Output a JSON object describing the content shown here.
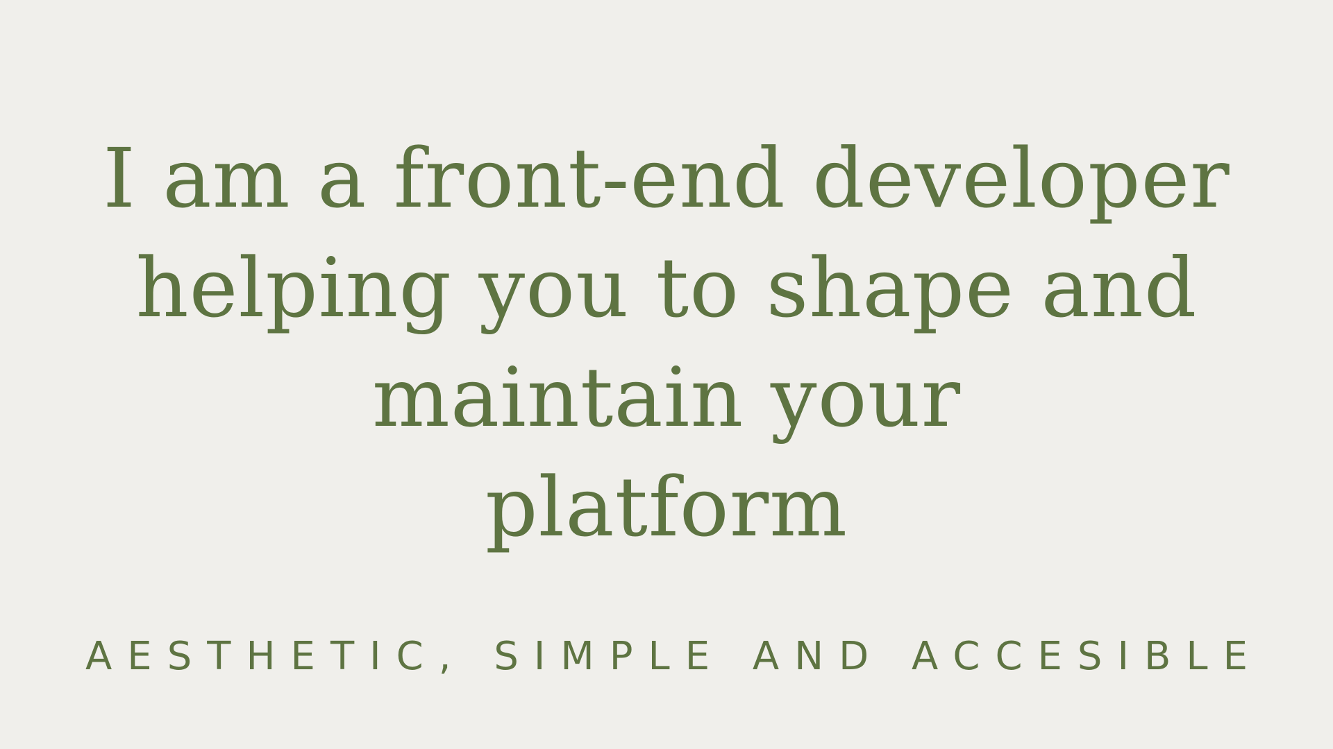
{
  "theme": {
    "background": "#f0efeb",
    "text_color": "#5e7442"
  },
  "hero": {
    "headline_lines": [
      "I am a front-end developer",
      "helping you to shape and",
      "maintain your",
      "platform"
    ],
    "tagline": "AESTHETIC, SIMPLE AND ACCESIBLE"
  }
}
